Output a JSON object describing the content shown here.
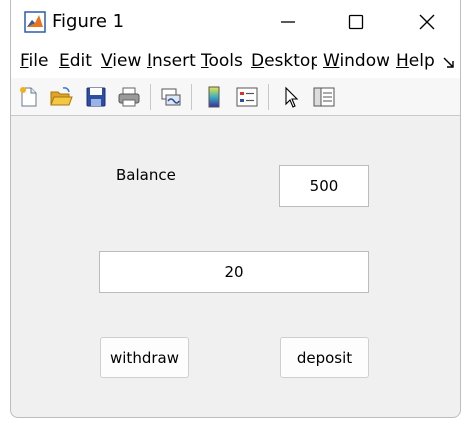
{
  "window": {
    "title": "Figure 1",
    "controls": {
      "minimize_icon": "minimize-icon",
      "maximize_icon": "maximize-icon",
      "close_icon": "close-icon"
    }
  },
  "menubar": {
    "items": [
      {
        "mnemonic": "F",
        "rest": "ile"
      },
      {
        "mnemonic": "E",
        "rest": "dit"
      },
      {
        "mnemonic": "V",
        "rest": "iew"
      },
      {
        "mnemonic": "I",
        "rest": "nsert"
      },
      {
        "mnemonic": "T",
        "rest": "ools"
      },
      {
        "mnemonic": "D",
        "rest": "esktop"
      },
      {
        "mnemonic": "W",
        "rest": "indow"
      },
      {
        "mnemonic": "H",
        "rest": "elp"
      }
    ],
    "overflow_icon": "overflow-arrow-icon"
  },
  "toolbar": {
    "icons": [
      "new-figure-icon",
      "open-file-icon",
      "save-icon",
      "print-icon",
      "link-plot-icon",
      "colorbar-icon",
      "legend-icon",
      "edit-plot-pointer-icon",
      "property-inspector-icon"
    ]
  },
  "app": {
    "balance_label": "Balance",
    "balance_value": "500",
    "amount_value": "20",
    "withdraw_label": "withdraw",
    "deposit_label": "deposit"
  },
  "colors": {
    "window_bg": "#f0f0f0",
    "titlebar_bg": "#ffffff",
    "edit_bg": "#ffffff"
  }
}
